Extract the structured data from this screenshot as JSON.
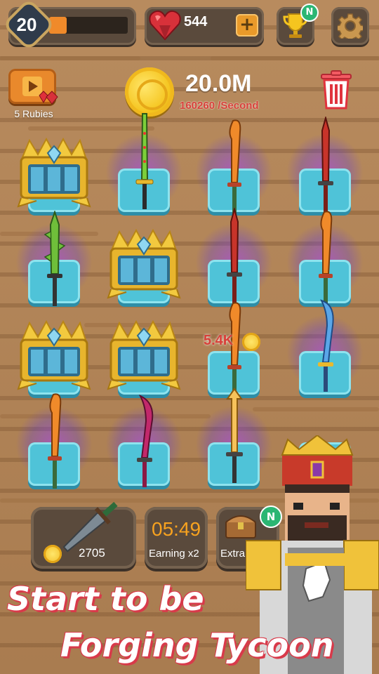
{
  "hud": {
    "level": "20",
    "xp_progress": 0.22,
    "rubies": "544",
    "plus_label": "+",
    "trophy_badge": "N",
    "colors": {
      "accent": "#f08a2a",
      "panel": "#5a4a3c",
      "ruby": "#d8313a"
    }
  },
  "reward": {
    "video_label": "5 Rubies"
  },
  "economy": {
    "money": "20.0M",
    "rate": "160260 /Second",
    "floating_income": "5.4K"
  },
  "grid": {
    "rows": 4,
    "cols": 4,
    "cells": [
      [
        "chest",
        "green-sword",
        "orange-blade",
        "red-sword"
      ],
      [
        "green-spiked-sword",
        "chest",
        "red-sword",
        "orange-blade"
      ],
      [
        "chest",
        "chest",
        "orange-blade",
        "blue-scimitar"
      ],
      [
        "orange-blade",
        "magenta-scimitar",
        "golden-arrow-sword",
        "empty"
      ]
    ]
  },
  "shop": {
    "buy_price": "2705",
    "timer": "05:49",
    "timer_label": "Earning x2",
    "extra_label": "Extra",
    "extra_badge": "N"
  },
  "banner": {
    "line1": "Start to be",
    "line2": "Forging Tycoon"
  }
}
